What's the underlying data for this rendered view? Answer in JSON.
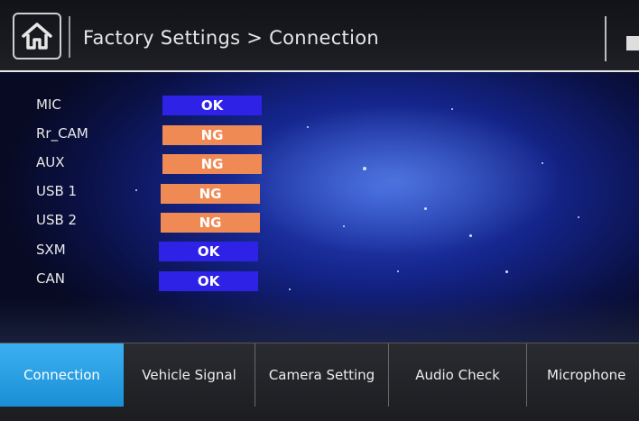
{
  "header": {
    "title": "Factory Settings > Connection",
    "home_icon": "home-icon"
  },
  "results": [
    {
      "label": "MIC",
      "status": "OK",
      "color": "#2e22e6"
    },
    {
      "label": "Rr_CAM",
      "status": "NG",
      "color": "#f08a55"
    },
    {
      "label": "AUX",
      "status": "NG",
      "color": "#f08a55"
    },
    {
      "label": "USB 1",
      "status": "NG",
      "color": "#f08a55"
    },
    {
      "label": "USB 2",
      "status": "NG",
      "color": "#f08a55"
    },
    {
      "label": "SXM",
      "status": "OK",
      "color": "#2e22e6"
    },
    {
      "label": "CAN",
      "status": "OK",
      "color": "#2e22e6"
    }
  ],
  "tabs": [
    {
      "label": "Connection",
      "active": true
    },
    {
      "label": "Vehicle Signal",
      "active": false
    },
    {
      "label": "Camera Setting",
      "active": false
    },
    {
      "label": "Audio Check",
      "active": false
    },
    {
      "label": "Microphone",
      "active": false
    }
  ]
}
